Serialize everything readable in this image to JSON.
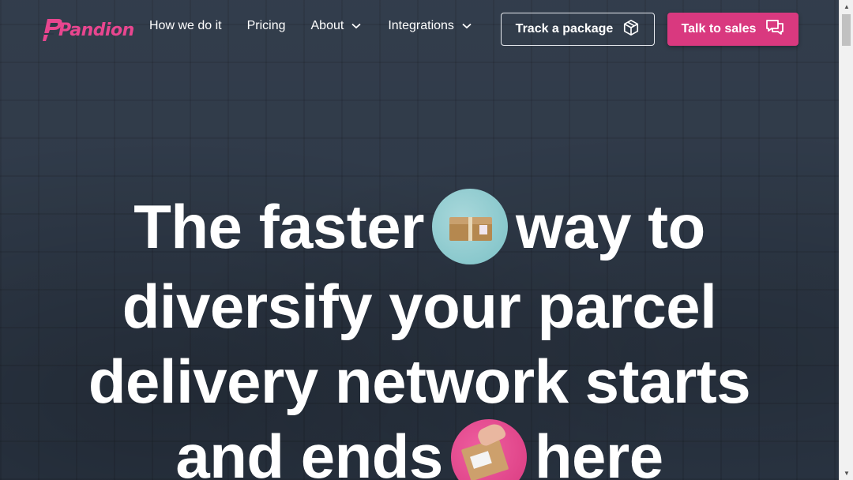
{
  "header": {
    "logo_text": "Pandion",
    "nav": [
      {
        "label": "How we do it",
        "has_dropdown": false
      },
      {
        "label": "Pricing",
        "has_dropdown": false
      },
      {
        "label": "About",
        "has_dropdown": true
      },
      {
        "label": "Integrations",
        "has_dropdown": true
      }
    ],
    "track_button": {
      "label": "Track a package",
      "icon": "package-icon"
    },
    "sales_button": {
      "label": "Talk to sales",
      "icon": "chat-icon"
    }
  },
  "hero": {
    "line1_a": "The faster",
    "line1_b": "way to",
    "line2": "diversify your parcel",
    "line3": "delivery network starts",
    "line4_a": "and ends",
    "line4_b": "here"
  },
  "colors": {
    "background": "#2c3746",
    "accent": "#d9397f",
    "text": "#ffffff"
  }
}
